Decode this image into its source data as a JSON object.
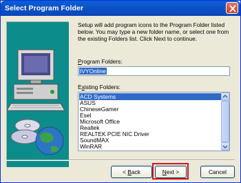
{
  "window": {
    "title": "Select Program Folder",
    "close_icon": "close-icon"
  },
  "content": {
    "description": "Setup will add program icons to the Program Folder listed below. You may type a new folder name, or select one from the existing Folders list.  Click Next to continue.",
    "program_folders_label_first": "P",
    "program_folders_label_rest": "rogram Folders:",
    "program_folder_value": "IVYOnline",
    "existing_folders_label_first": "x",
    "existing_folders_label_pre": "E",
    "existing_folders_label_rest": "isting Folders:",
    "existing_folders": [
      "ACD Systems",
      "ASUS",
      "ChineseGamer",
      "Esel",
      "Microsoft Office",
      "Realtek",
      "REALTEK PCIE NIC Driver",
      "SoundMAX",
      "WinRAR"
    ],
    "selected_folder": "ACD Systems"
  },
  "buttons": {
    "back_pre": "< ",
    "back_u": "B",
    "back_rest": "ack",
    "next_u": "N",
    "next_rest": "ext >",
    "cancel": "Cancel"
  },
  "colors": {
    "titlebar": "#0a5fd8",
    "selection": "#316ac5",
    "highlight_border": "#d4171b"
  }
}
